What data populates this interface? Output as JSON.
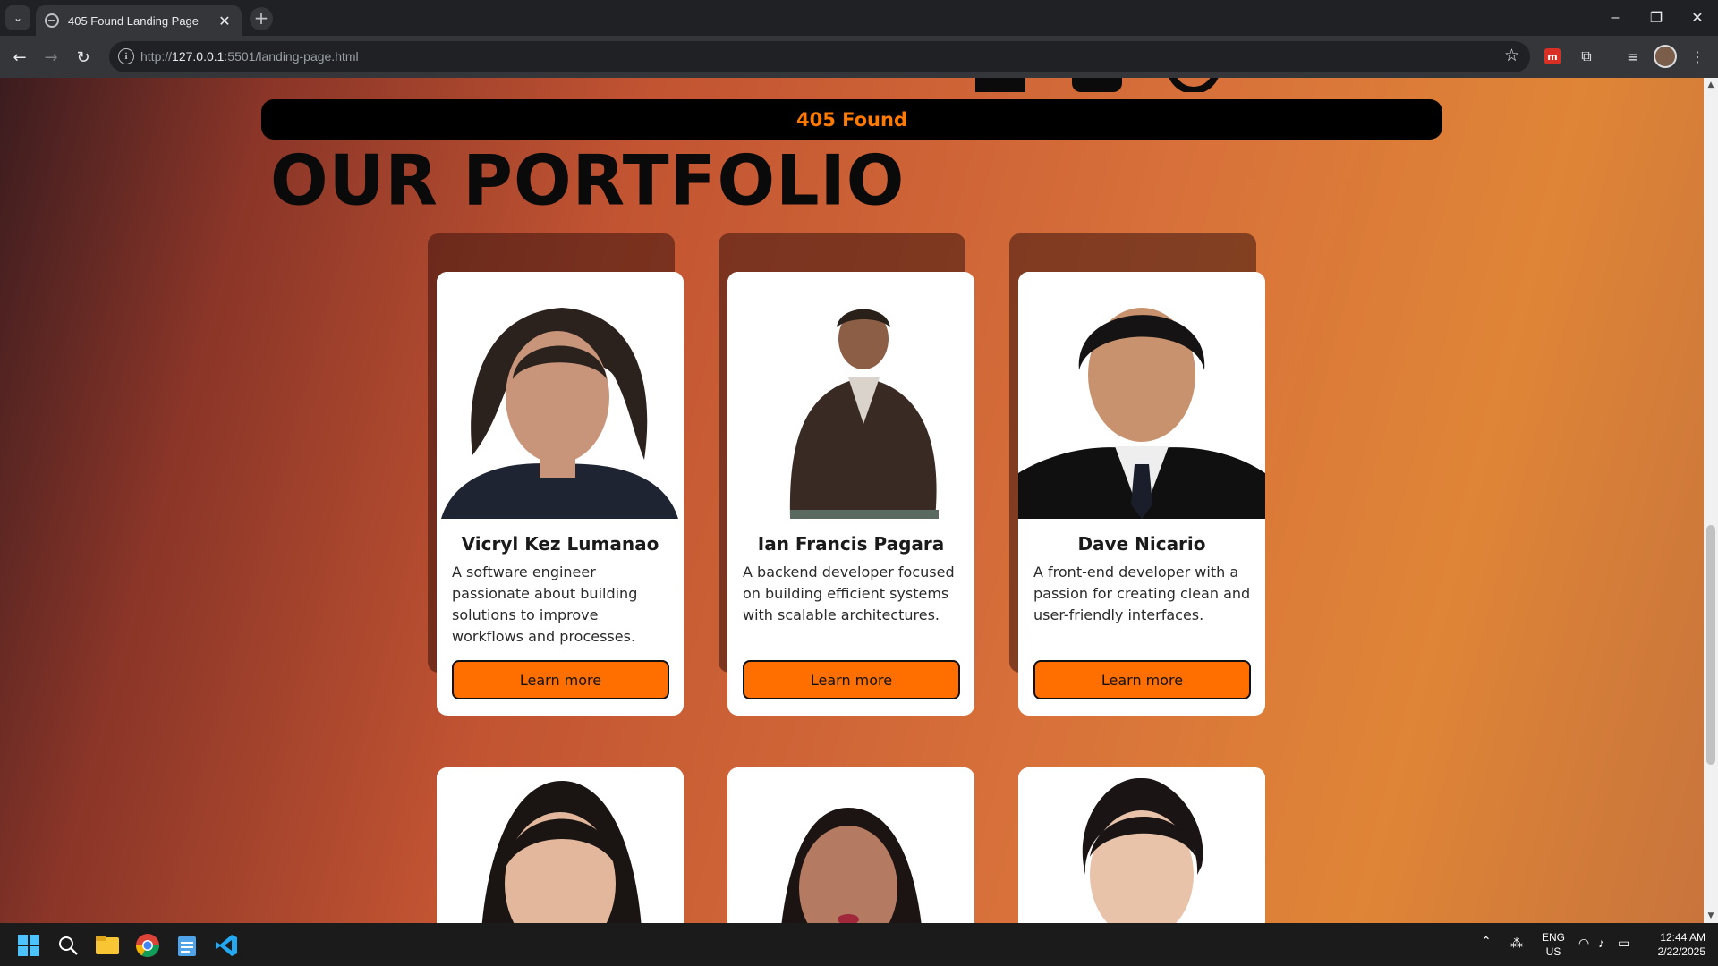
{
  "browser": {
    "tab_title": "405 Found Landing Page",
    "tab_close": "✕",
    "new_tab": "+",
    "url_prefix": "http://",
    "url_host": "127.0.0.1",
    "url_rest": ":5501/landing-page.html",
    "window_controls": {
      "minimize": "–",
      "maximize": "❐",
      "close": "✕"
    }
  },
  "page": {
    "banner": "405 Found",
    "section_title": "OUR PORTFOLIO",
    "members": [
      {
        "name": "Vicryl Kez Lumanao",
        "description": "A software engineer passionate about building solutions to improve workflows and processes.",
        "button": "Learn more"
      },
      {
        "name": "Ian Francis Pagara",
        "description": "A backend developer focused on building efficient systems with scalable architectures.",
        "button": "Learn more"
      },
      {
        "name": "Dave Nicario",
        "description": "A front-end developer with a passion for creating clean and user-friendly interfaces.",
        "button": "Learn more"
      }
    ]
  },
  "taskbar": {
    "language": "ENG",
    "region": "US",
    "time": "12:44 AM",
    "date": "2/22/2025"
  },
  "colors": {
    "accent_orange": "#ff6f00",
    "banner_text": "#ff7a00",
    "chrome_dark": "#202124"
  }
}
